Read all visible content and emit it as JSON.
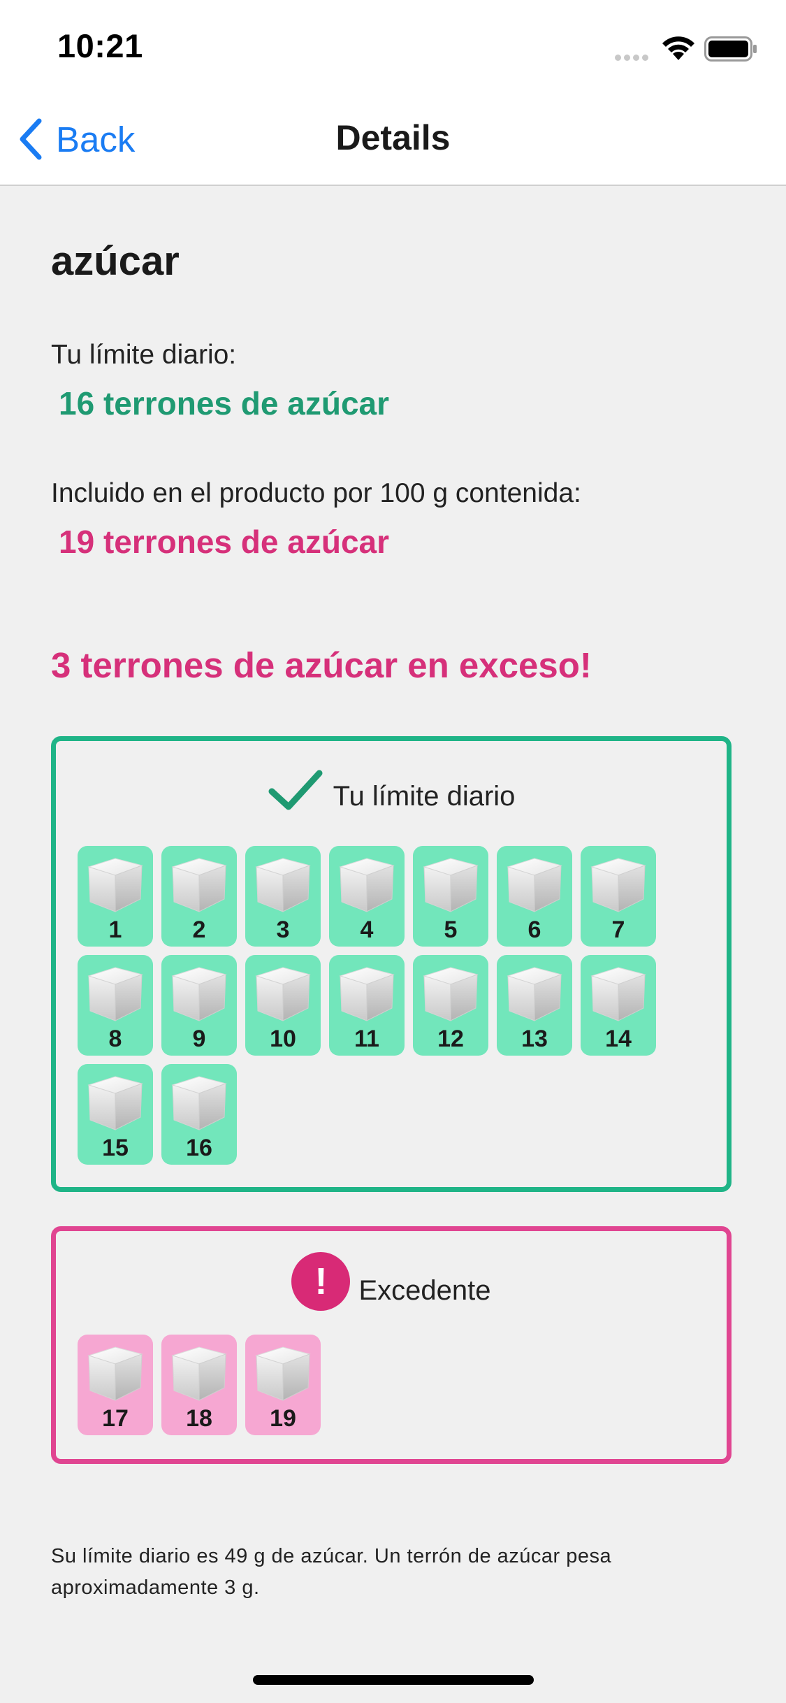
{
  "status_bar": {
    "time": "10:21"
  },
  "nav": {
    "back_label": "Back",
    "title": "Details"
  },
  "product": {
    "name": "azúcar"
  },
  "daily_limit": {
    "label": "Tu límite diario:",
    "value": "16 terrones de azúcar"
  },
  "contained": {
    "label": "Incluido en el producto por 100 g contenida:",
    "value": "19 terrones de azúcar"
  },
  "excess_headline": "3 terrones de azúcar en exceso!",
  "limit_box": {
    "icon": "checkmark-icon",
    "title": "Tu límite diario",
    "color": "#1fb487",
    "tile_color": "#72e6bb",
    "cubes": [
      "1",
      "2",
      "3",
      "4",
      "5",
      "6",
      "7",
      "8",
      "9",
      "10",
      "11",
      "12",
      "13",
      "14",
      "15",
      "16"
    ]
  },
  "excess_box": {
    "icon": "exclamation-circle-icon",
    "icon_glyph": "!",
    "title": "Excedente",
    "color": "#e04591",
    "tile_color": "#f6a7d2",
    "cubes": [
      "17",
      "18",
      "19"
    ]
  },
  "footnote": "Su límite diario es 49 g de azúcar. Un terrón de azúcar pesa aproximadamente 3 g.",
  "colors": {
    "accent_blue": "#1a7cf3",
    "green": "#1f9a72",
    "pink": "#d6307a"
  }
}
